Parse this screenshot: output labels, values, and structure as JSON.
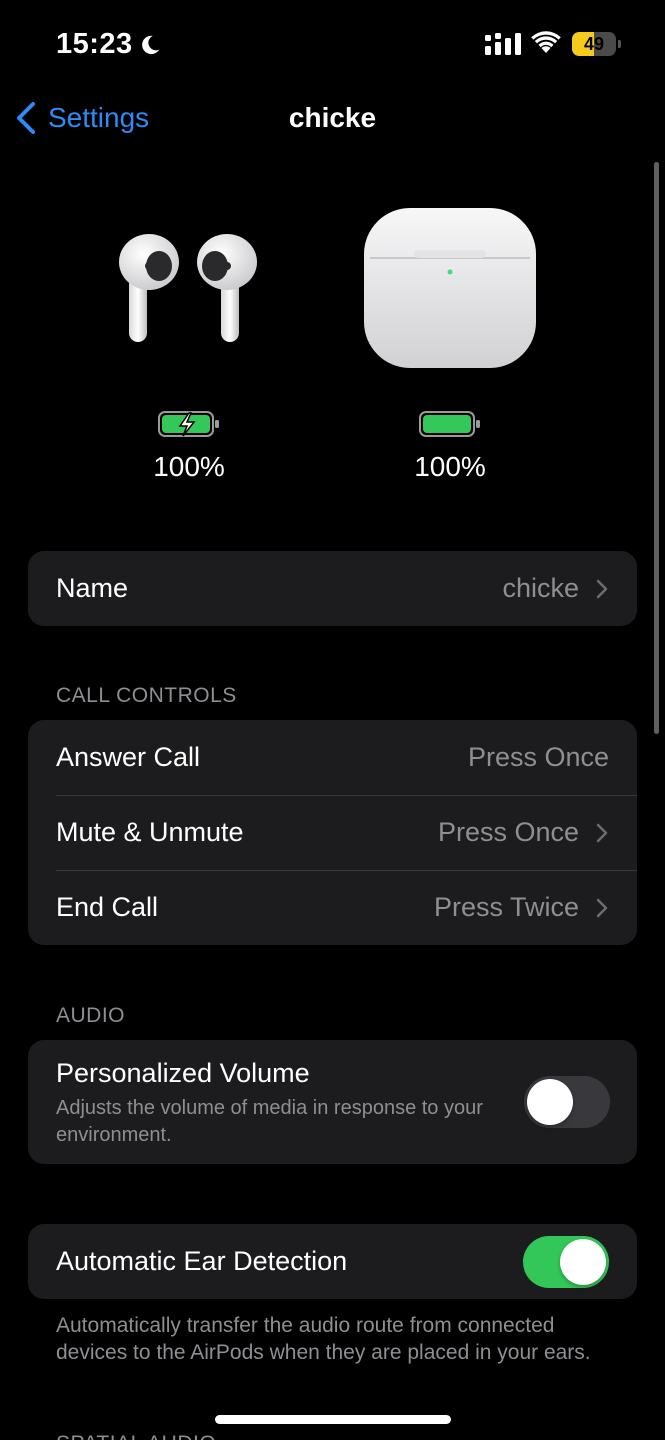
{
  "status_bar": {
    "time": "15:23",
    "battery_level": "49",
    "battery_color": "#f5cc1b",
    "icons": [
      "moon-icon",
      "cellular-signal-icon",
      "wifi-icon",
      "battery-icon"
    ]
  },
  "nav": {
    "back_label": "Settings",
    "title": "chicke",
    "accent_color": "#2f8af5"
  },
  "hero": {
    "buds_battery": "100%",
    "buds_charging": true,
    "case_battery": "100%",
    "case_charging": false,
    "battery_color": "#34c759"
  },
  "name_row": {
    "label": "Name",
    "value": "chicke"
  },
  "call_controls": {
    "header": "CALL CONTROLS",
    "rows": [
      {
        "label": "Answer Call",
        "value": "Press Once",
        "chevron": false
      },
      {
        "label": "Mute & Unmute",
        "value": "Press Once",
        "chevron": true
      },
      {
        "label": "End Call",
        "value": "Press Twice",
        "chevron": true
      }
    ]
  },
  "audio": {
    "header": "AUDIO",
    "personalized_volume": {
      "label": "Personalized Volume",
      "description": "Adjusts the volume of media in response to your environment.",
      "enabled": false
    }
  },
  "ear_detection": {
    "label": "Automatic Ear Detection",
    "enabled": true,
    "note": "Automatically transfer the audio route from connected devices to the AirPods when they are placed in your ears.",
    "toggle_color": "#33c759"
  },
  "next_section": {
    "header": "SPATIAL AUDIO"
  }
}
